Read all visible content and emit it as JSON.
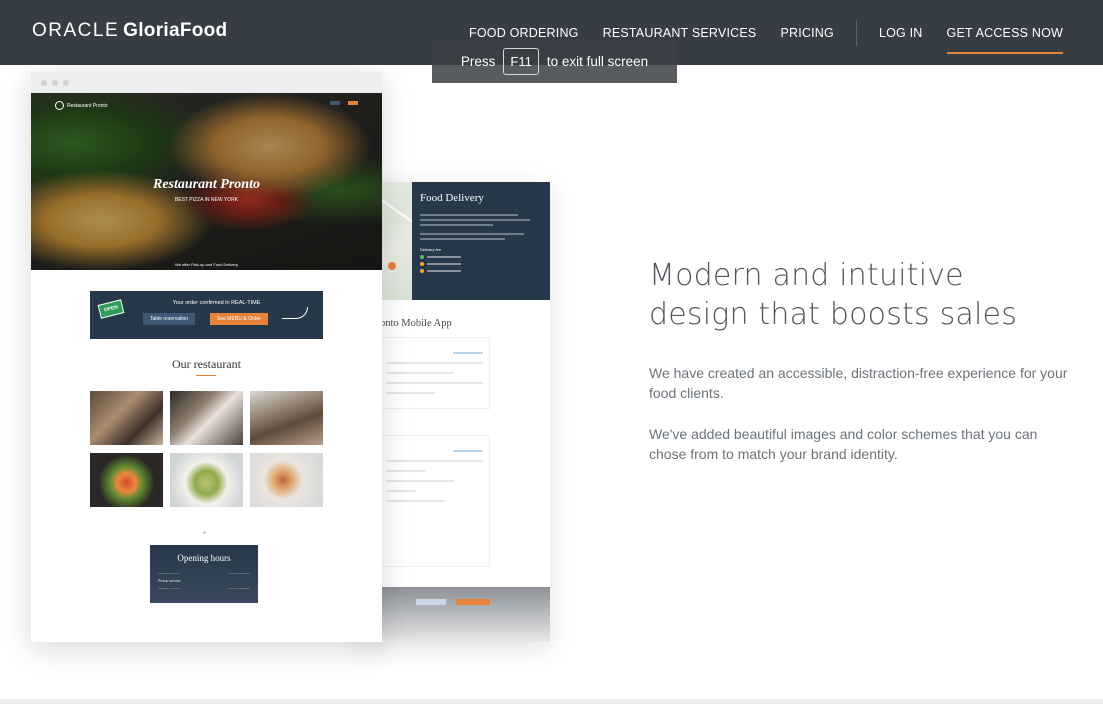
{
  "header": {
    "logo_prefix": "ORACLE",
    "logo_brand": "GloriaFood",
    "nav": [
      {
        "label": "FOOD ORDERING"
      },
      {
        "label": "RESTAURANT SERVICES"
      },
      {
        "label": "PRICING"
      },
      {
        "label": "LOG IN"
      },
      {
        "label": "GET ACCESS NOW"
      }
    ]
  },
  "fullscreen_toast": {
    "press": "Press",
    "key": "F11",
    "message": "to exit full screen"
  },
  "mockup": {
    "site_name": "Restaurant Pronto",
    "hero_title": "Restaurant Pronto",
    "hero_subtitle": "BEST PIZZA IN NEW YORK",
    "hero_bottom": "We offer Pick-up and Food Delivery",
    "order_text": "Your order confirmed in REAL-TIME",
    "open_sign": "OPEN",
    "table_reservation": "Table reservation",
    "see_menu": "See MENU & Order",
    "our_restaurant": "Our restaurant",
    "opening_hours": "Opening hours",
    "pickup_service": "Pickup service",
    "food_delivery_title": "Food Delivery",
    "delivery_fee": "Delivery fee",
    "mobile_app_title": "onto Mobile App"
  },
  "content": {
    "headline": "Modern and intuitive design that boosts sales",
    "paragraph1": "We have created an accessible, distraction-free experience for your food clients.",
    "paragraph2": "We've added beautiful images and color schemes that you can chose from to match your brand identity."
  },
  "colors": {
    "nav_bg": "#363d45",
    "accent": "#e8823a",
    "panel_navy": "#27384a"
  }
}
